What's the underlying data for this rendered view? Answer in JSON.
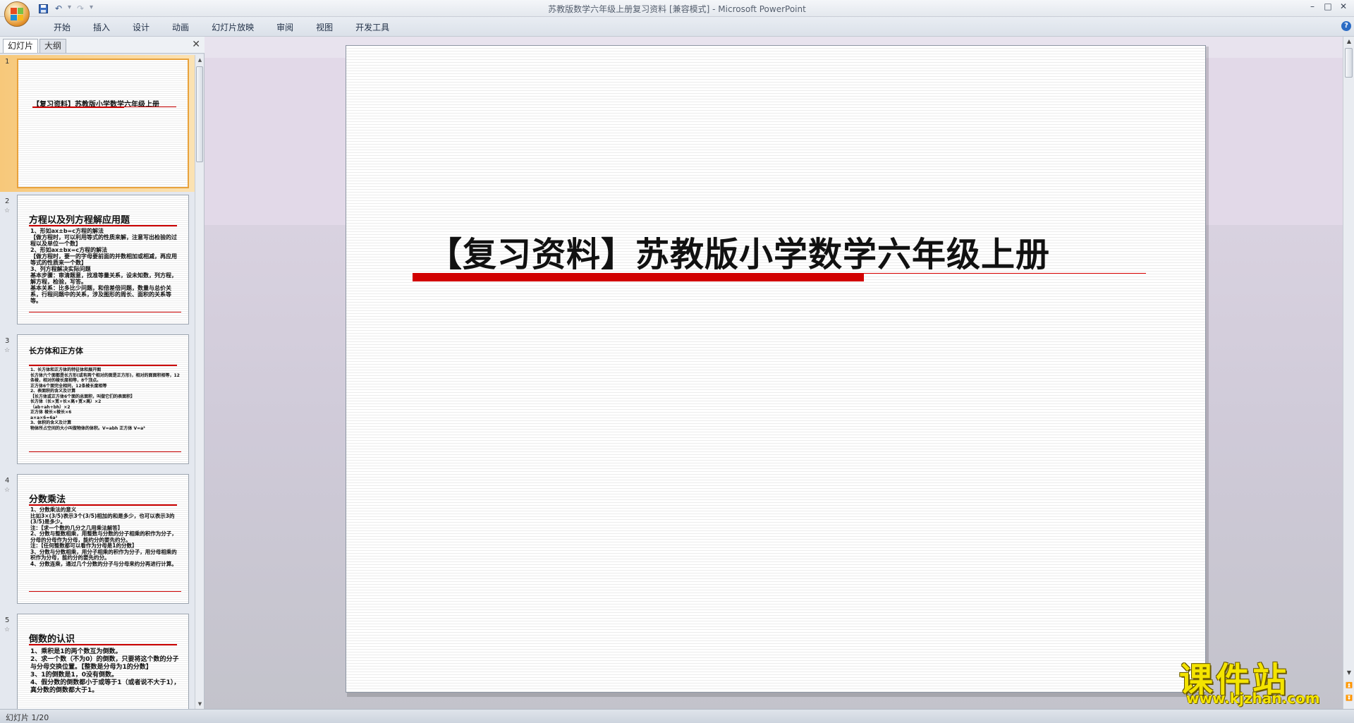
{
  "window": {
    "title": "苏教版数学六年级上册复习资料 [兼容模式] - Microsoft PowerPoint",
    "controls": [
      "–",
      "□",
      "✕"
    ]
  },
  "ribbon": {
    "tabs": [
      "开始",
      "插入",
      "设计",
      "动画",
      "幻灯片放映",
      "审阅",
      "视图",
      "开发工具"
    ],
    "help": "?"
  },
  "panel": {
    "tab_slides": "幻灯片",
    "tab_outline": "大纲",
    "close": "✕"
  },
  "thumbnails": [
    {
      "num": "1",
      "title": "【复习资料】苏教版小学数学六年级上册"
    },
    {
      "num": "2",
      "title": "方程以及列方程解应用题",
      "lines": [
        "1、形如ax±b=c方程的解法",
        "【做方程时，可以利用等式的性质来解，注意写出检验的过程以及单位一个数】",
        "2、形如ax±bx=c方程的解法",
        "【做方程时，要一的字母要前面的并数相加或相减，再应用等式的性质来一个数】",
        "3、列方程解决实际问题",
        "基本步骤：审清题意，找准等量关系，设未知数，列方程，解方程，检验，写答。",
        "基本关系：比多比少问题，和倍差倍问题，数量与总价关系，行程问题中的关系，涉及图形的周长、面积的关系等等。"
      ]
    },
    {
      "num": "3",
      "title": "长方体和正方体",
      "lines": [
        "1、长方体和正方体的特征体和展开图",
        "长方体六个面都是长方形(或有两个相对的面是正方形)，相对的面面积相等，12条棱，相对的棱长度相等，8个顶点。",
        "正方体6个面完全相同，12条棱长度相等",
        "2、表面积的含义及计算",
        "【长方体或正方体6个面的总面积，叫做它们的表面积】",
        "长方体（长×宽+长×高+宽×高）×2",
        "（ab+ah+bh）×2",
        "正方体 棱长×棱长×6",
        "a×a×6=6a²",
        "3、体积的含义及计算",
        "物体所占空间的大小叫做物体的体积。V=abh 正方体 V=a³"
      ]
    },
    {
      "num": "4",
      "title": "分数乘法",
      "lines": [
        "1、分数乘法的意义",
        "比如3×(3/5)表示3个(3/5)相加的和是多少，也可以表示3的(3/5)是多少。",
        "注：【求一个数的几分之几用乘法解答】",
        "2、分数与整数相乘，用整数与分数的分子相乘的积作为分子，分母的分母作为分母，能约分的要先约分。",
        "注：【任何整数都可以看作为分母是1的分数】",
        "3、分数与分数相乘，用分子相乘的积作为分子，用分母相乘的积作为分母，能约分的要先约分。",
        "4、分数连乘，通过几个分数的分子与分母来约分再进行计算。"
      ]
    },
    {
      "num": "5",
      "title": "倒数的认识",
      "lines": [
        "1、乘积是1的两个数互为倒数。",
        "2、求一个数（不为0）的倒数，只要将这个数的分子与分母交换位置。【整数是分母为1的分数】",
        "3、1的倒数是1，0没有倒数。",
        "4、假分数的倒数都小于或等于1（或者说不大于1），真分数的倒数都大于1。"
      ]
    }
  ],
  "slide": {
    "title": "【复习资料】苏教版小学数学六年级上册"
  },
  "status": {
    "text": "幻灯片 1/20"
  },
  "watermark": {
    "main": "课件站",
    "url": "www.kjzhan.com"
  },
  "colors": {
    "accent_red": "#d10000",
    "selection": "#f7c87a",
    "watermark": "#f4e400"
  }
}
